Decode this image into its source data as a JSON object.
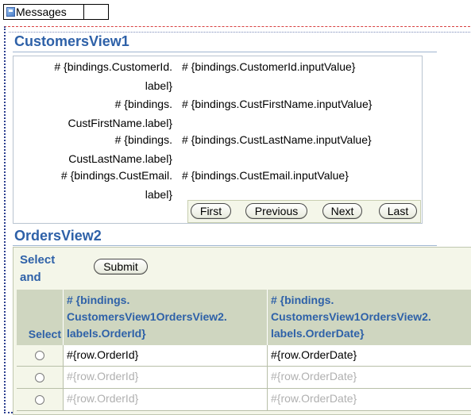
{
  "messages": {
    "label": "Messages"
  },
  "customers": {
    "title": "CustomersView1",
    "fields": [
      {
        "label_l1": "# {bindings.CustomerId.",
        "label_l2": "label}",
        "value": "# {bindings.CustomerId.inputValue}"
      },
      {
        "label_l1": "# {bindings.",
        "label_l2": "CustFirstName.label}",
        "value": "# {bindings.CustFirstName.inputValue}"
      },
      {
        "label_l1": "# {bindings.",
        "label_l2": "CustLastName.label}",
        "value": "# {bindings.CustLastName.inputValue}"
      },
      {
        "label_l1": "# {bindings.CustEmail.",
        "label_l2": "label}",
        "value": "# {bindings.CustEmail.inputValue}"
      }
    ],
    "nav": {
      "first": "First",
      "previous": "Previous",
      "next": "Next",
      "last": "Last"
    }
  },
  "orders": {
    "title": "OrdersView2",
    "select_and_l1": "Select",
    "select_and_l2": "and",
    "submit": "Submit",
    "headers": {
      "select": "Select",
      "col1_l1": "# {bindings.",
      "col1_l2": "CustomersView1OrdersView2.",
      "col1_l3": "labels.OrderId}",
      "col2_l1": "# {bindings.",
      "col2_l2": "CustomersView1OrdersView2.",
      "col2_l3": "labels.OrderDate}"
    },
    "rows": [
      {
        "order_id": "#{row.OrderId}",
        "order_date": "#{row.OrderDate}"
      },
      {
        "order_id": "#{row.OrderId}",
        "order_date": "#{row.OrderDate}"
      },
      {
        "order_id": "#{row.OrderId}",
        "order_date": "#{row.OrderDate}"
      }
    ]
  }
}
